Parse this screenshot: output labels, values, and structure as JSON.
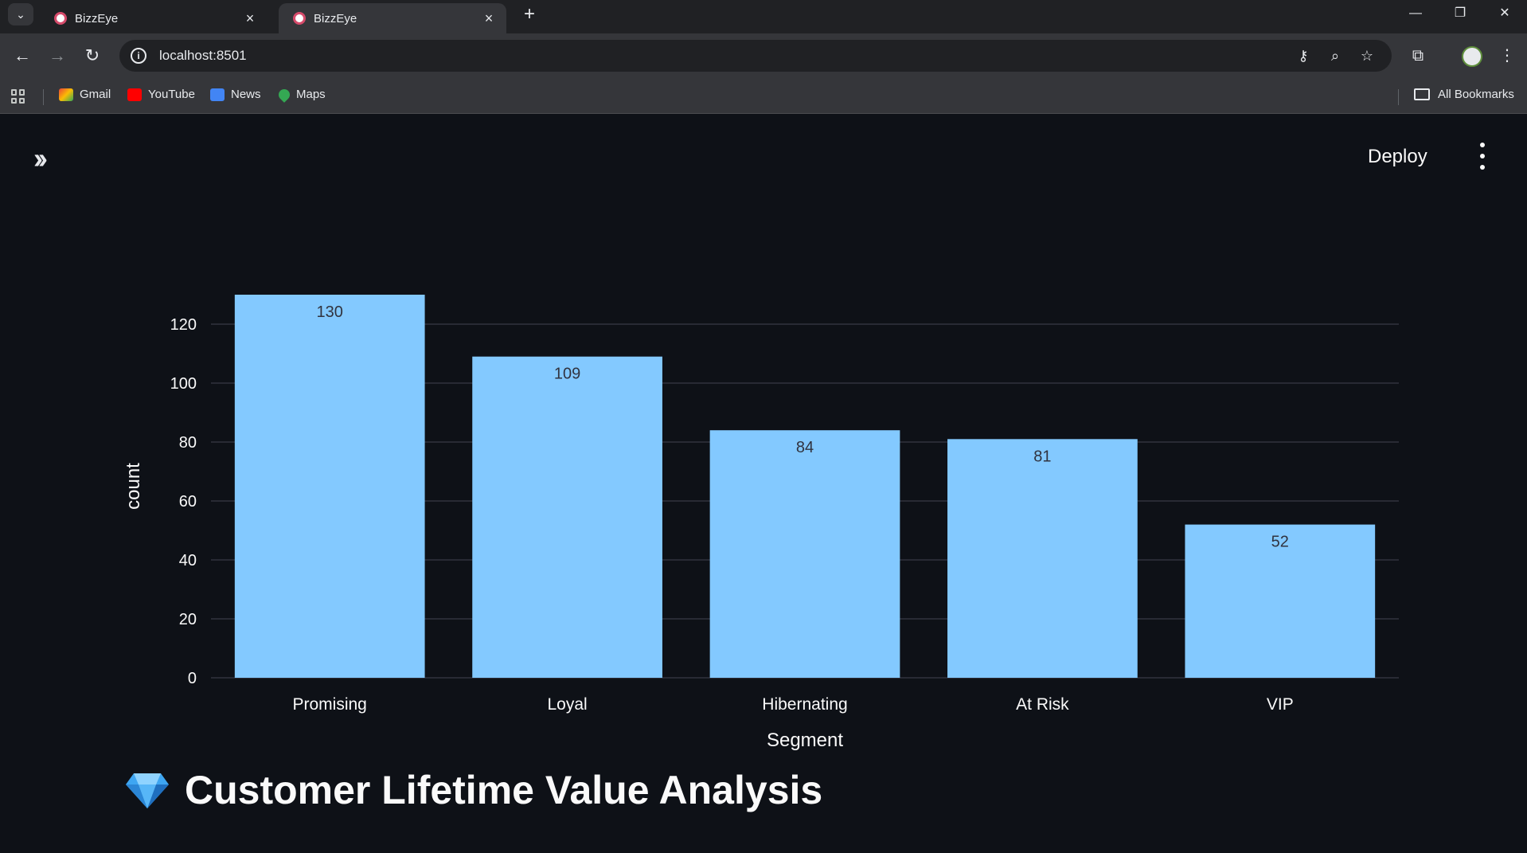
{
  "browser": {
    "tabs": [
      {
        "title": "BizzEye",
        "active": false
      },
      {
        "title": "BizzEye",
        "active": true
      }
    ],
    "url": "localhost:8501",
    "bookmarks": [
      "Gmail",
      "YouTube",
      "News",
      "Maps"
    ],
    "all_bookmarks_label": "All Bookmarks"
  },
  "app": {
    "deploy_label": "Deploy",
    "section_title": "Customer Lifetime Value Analysis",
    "bar_color": "#83c9ff",
    "background": "#0e1117"
  },
  "chart_data": {
    "type": "bar",
    "categories": [
      "Promising",
      "Loyal",
      "Hibernating",
      "At Risk",
      "VIP"
    ],
    "values": [
      130,
      109,
      84,
      81,
      52
    ],
    "data_labels": [
      "130",
      "109",
      "84",
      "81",
      "52"
    ],
    "xlabel": "Segment",
    "ylabel": "count",
    "ylim": [
      0,
      130
    ],
    "yticks": [
      0,
      20,
      40,
      60,
      80,
      100,
      120
    ],
    "grid": true
  }
}
